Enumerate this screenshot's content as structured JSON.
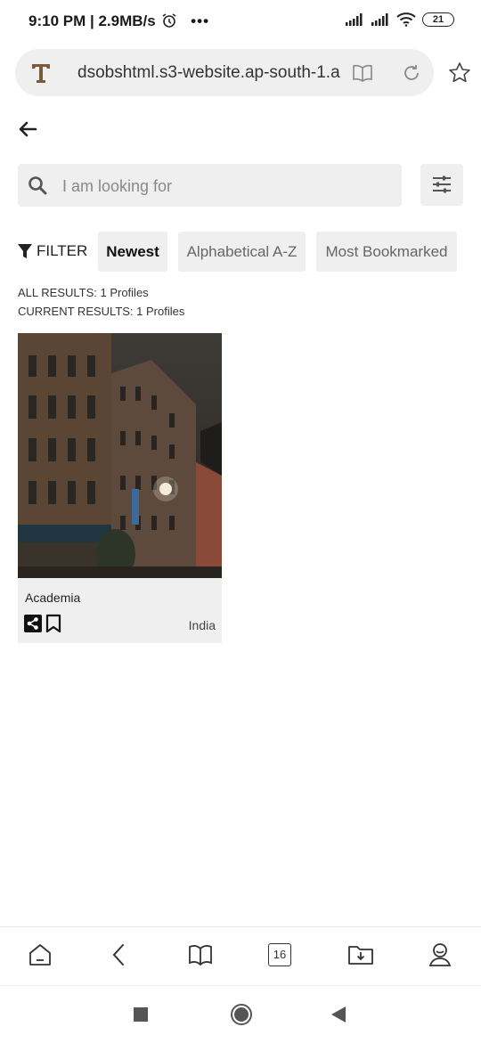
{
  "status_bar": {
    "time": "9:10 PM | 2.9MB/s",
    "more": "•••",
    "battery": "21"
  },
  "browser": {
    "url": "dsobshtml.s3-website.ap-south-1.a",
    "tab_count": "16"
  },
  "search": {
    "placeholder": "I am looking for"
  },
  "filter": {
    "label": "FILTER",
    "sort_options": [
      "Newest",
      "Alphabetical A-Z",
      "Most Bookmarked"
    ],
    "selected": "Newest"
  },
  "results": {
    "all": "ALL RESULTS: 1 Profiles",
    "current": "CURRENT RESULTS: 1 Profiles"
  },
  "profiles": [
    {
      "title": "Academia",
      "country": "India"
    }
  ],
  "icons": {
    "site_favicon": "T"
  }
}
